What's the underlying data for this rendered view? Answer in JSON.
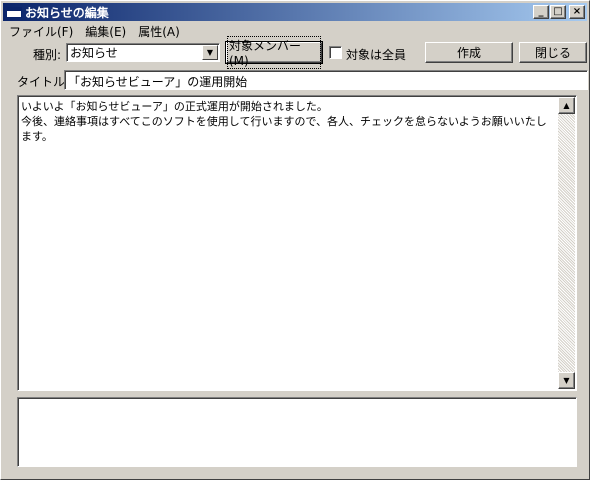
{
  "window": {
    "title": "お知らせの編集",
    "minimize": "_",
    "maximize": "□",
    "close": "×"
  },
  "menu": [
    {
      "label": "ファイル(F)"
    },
    {
      "label": "編集(E)"
    },
    {
      "label": "属性(A)"
    }
  ],
  "form": {
    "type_label": "種別:",
    "type_value": "お知らせ",
    "members_button": "対象メンバー(M)",
    "all_label": "対象は全員",
    "all_checked": false,
    "create_button": "作成",
    "close_button": "閉じる",
    "title_label": "タイトル:",
    "title_value": "「お知らせビューア」の運用開始"
  },
  "body": {
    "text": "いよいよ「お知らせビューア」の正式運用が開始されました。\n今後、連絡事項はすべてこのソフトを使用して行いますので、各人、チェックを怠らないようお願いいたします。"
  },
  "colors": {
    "title_gradient_start": "#0a246a",
    "title_gradient_end": "#a6caf0",
    "face": "#d4d0c8"
  }
}
